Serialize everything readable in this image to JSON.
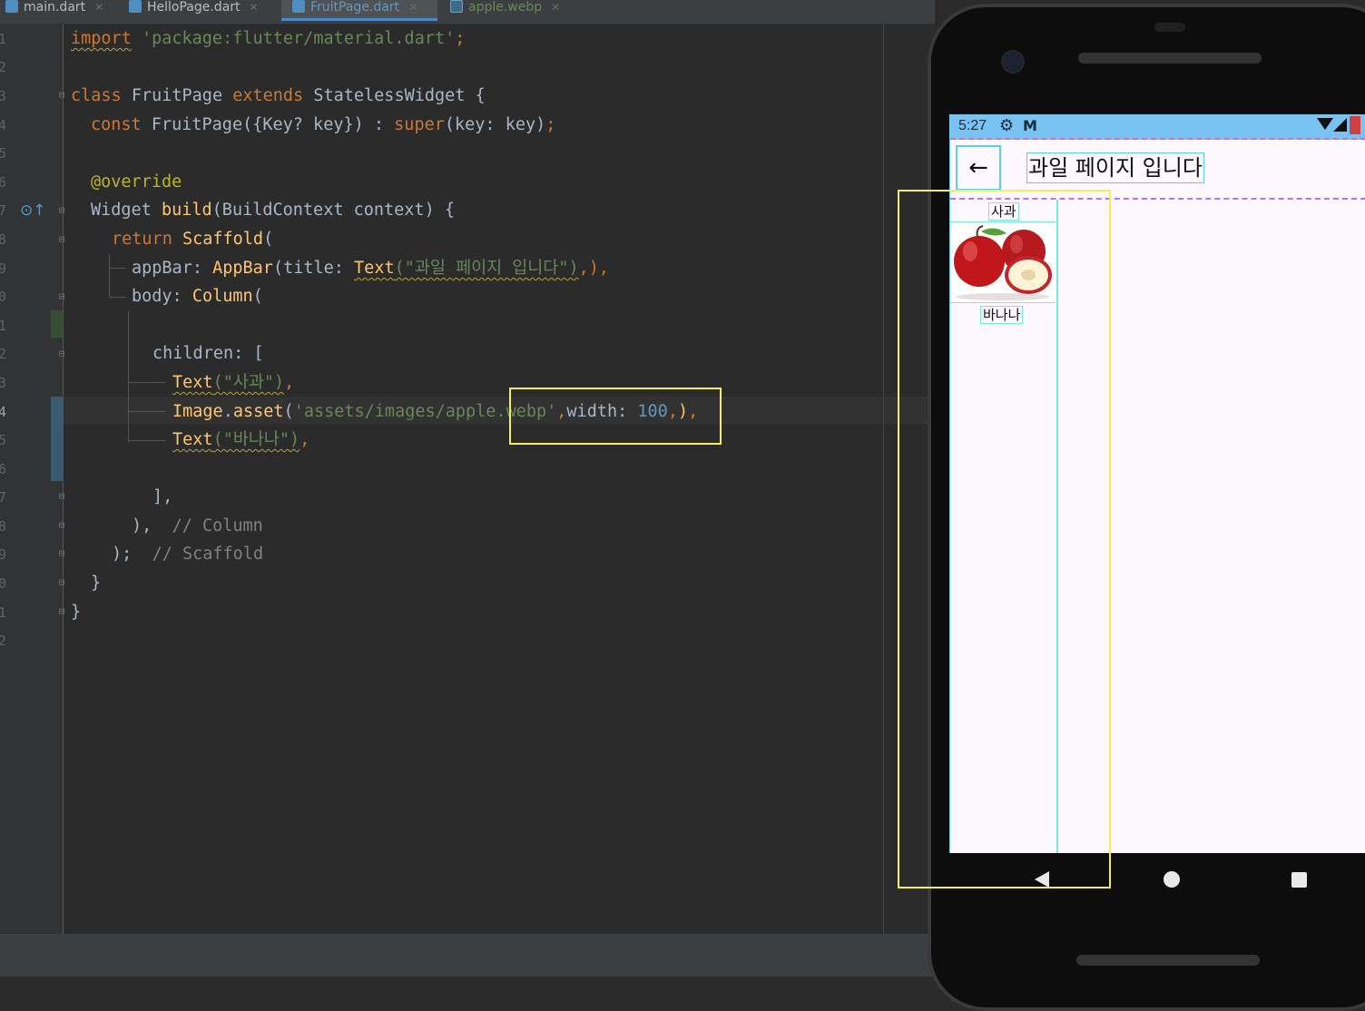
{
  "tabs": [
    {
      "label": "main.dart"
    },
    {
      "label": "HelloPage.dart"
    },
    {
      "label": "FruitPage.dart"
    },
    {
      "label": "apple.webp"
    }
  ],
  "code": {
    "import": "import",
    "import_path": "'package:flutter/material.dart'",
    "semi": ";",
    "class_kw": "class",
    "class_name": "FruitPage",
    "extends_kw": "extends",
    "super_class": "StatelessWidget {",
    "const_kw": "const",
    "ctor": "FruitPage({Key? key}) :",
    "super_kw": "super",
    "super_args": "(key: key)",
    "override": "@override",
    "build_ret": "Widget",
    "build_name": "build",
    "build_args": "(BuildContext context) {",
    "return_kw": "return",
    "scaffold": "Scaffold",
    "appbar_key": "appBar: ",
    "appbar_fn": "AppBar",
    "title_key": "(title: ",
    "text_fn": "Text",
    "appbar_title_str": "(\"과일 페이지 입니다\")",
    "appbar_close": ",),",
    "body_key": "body: ",
    "column_fn": "Column",
    "children_key": "children: [",
    "text1": "(\"사과\")",
    "image_fn": "Image",
    "asset_fn": "asset",
    "image_path": "'assets/images/apple.webp'",
    "width_key": "width: ",
    "width_val": "100",
    "text2": "(\"바나나\")",
    "close_bracket": "],",
    "column_close": "),",
    "column_comment": "// Column",
    "scaffold_close": ");",
    "scaffold_comment": "// Scaffold",
    "brace1": "}",
    "brace2": "}"
  },
  "line_numbers": [
    "1",
    "2",
    "3",
    "4",
    "5",
    "6",
    "7",
    "8",
    "9",
    "0",
    "1",
    "2",
    "3",
    "4",
    "5",
    "6",
    "7",
    "8",
    "9",
    "0",
    "1",
    "2"
  ],
  "phone": {
    "time": "5:27",
    "status_icons": [
      "settings-icon",
      "gmail-icon",
      "wifi-icon",
      "signal-icon"
    ],
    "app_title": "과일 페이지 입니다",
    "text1": "사과",
    "text2": "바나나",
    "back_glyph": "←"
  }
}
